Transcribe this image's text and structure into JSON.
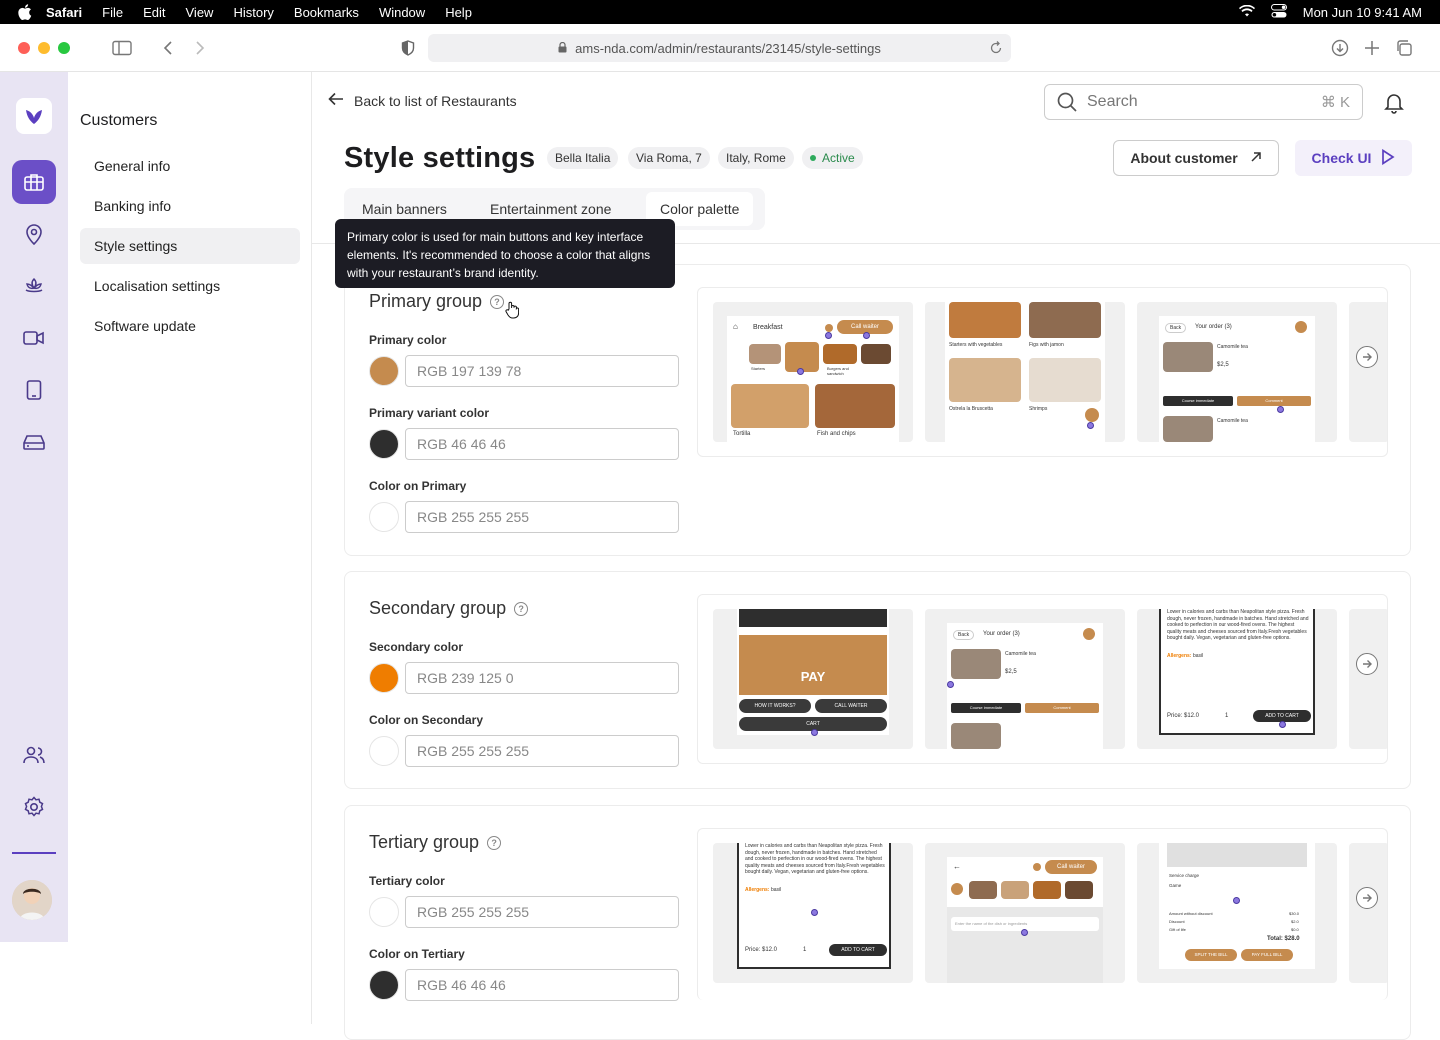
{
  "menubar": {
    "app": "Safari",
    "items": [
      "File",
      "Edit",
      "View",
      "History",
      "Bookmarks",
      "Window",
      "Help"
    ],
    "datetime": "Mon Jun 10  9:41 AM"
  },
  "browser": {
    "url": "ams-nda.com/admin/restaurants/23145/style-settings"
  },
  "sidebar": {
    "heading": "Customers",
    "items": [
      {
        "label": "General info"
      },
      {
        "label": "Banking info"
      },
      {
        "label": "Style settings",
        "active": true
      },
      {
        "label": "Localisation settings"
      },
      {
        "label": "Software update"
      }
    ]
  },
  "header": {
    "back_label": "Back to list of Restaurants",
    "search_placeholder": "Search",
    "search_shortcut": "⌘ K",
    "title": "Style settings",
    "chips": [
      "Bella Italia",
      "Via Roma, 7",
      "Italy, Rome"
    ],
    "status": "Active",
    "about_button": "About customer",
    "check_button": "Check UI"
  },
  "tabs": [
    {
      "label": "Main banners"
    },
    {
      "label": "Entertainment zone"
    },
    {
      "label": "Color palette",
      "active": true
    }
  ],
  "tooltip": "Primary color is used for main buttons and key interface elements. It's recommended to choose a color that aligns with your restaurant’s brand identity.",
  "groups": {
    "primary": {
      "title": "Primary group",
      "fields": [
        {
          "label": "Primary color",
          "value": "RGB 197 139 78",
          "color": "#c58b4e"
        },
        {
          "label": "Primary variant color",
          "value": "RGB 46 46 46",
          "color": "#2e2e2e"
        },
        {
          "label": "Color on Primary",
          "value": "RGB 255 255 255",
          "color": "#ffffff"
        }
      ],
      "preview": {
        "breakfast": "Breakfast",
        "call_waiter": "Call waiter",
        "cats": [
          "Starters",
          "Breakfast",
          "Burgers and sandwich",
          "Meat"
        ],
        "items": [
          "Tortilla",
          "Fish and chips"
        ],
        "menu_items": [
          "Starters with vegetables",
          "Figs with jamon",
          "Ostrela la Bruscetta",
          "Shrimps"
        ],
        "back": "Back",
        "order": "Your order (3)",
        "tea": "Camomile tea",
        "price": "$2,5",
        "course": "Course immediate",
        "comment": "Comment"
      }
    },
    "secondary": {
      "title": "Secondary group",
      "fields": [
        {
          "label": "Secondary color",
          "value": "RGB 239 125 0",
          "color": "#ef7d00"
        },
        {
          "label": "Color on Secondary",
          "value": "RGB 255 255 255",
          "color": "#ffffff"
        }
      ],
      "preview": {
        "pay": "PAY",
        "how": "HOW IT WORKS?",
        "call": "CALL WAITER",
        "cart": "CART",
        "desc": "Lower in calories and carbs than Neapolitan style pizza. Fresh dough, never frozen, handmade in batches. Hand stretched and cooked to perfection in our wood-fired ovens. The highest quality meats and cheeses sourced from Italy.Fresh vegetables bought daily. Vegan, vegetarian and gluten-free options.",
        "allergens": "Allergens:",
        "allergen_val": "basil",
        "price": "Price: $12.0",
        "qty": "1",
        "add": "ADD TO CART"
      }
    },
    "tertiary": {
      "title": "Tertiary group",
      "fields": [
        {
          "label": "Tertiary color",
          "value": "RGB 255 255 255",
          "color": "#ffffff"
        },
        {
          "label": "Color on Tertiary",
          "value": "RGB 46 46 46",
          "color": "#2e2e2e"
        }
      ],
      "preview": {
        "search_hint": "Enter the name of the dish or ingredients",
        "service": "Service charge",
        "game": "Game",
        "amount": "Amount without discount",
        "discount": "Discount",
        "gift": "Gift of life",
        "amount_val": "$30.0",
        "discount_val": "$2.0",
        "gift_val": "$0.0",
        "total": "Total: $28.0",
        "split": "SPLIT THE BILL",
        "payfull": "PAY FULL BILL"
      }
    }
  },
  "colors": {
    "accent": "#6b4fc7",
    "brand_primary": "#c58b4e",
    "status_active": "#2eaa5c"
  }
}
